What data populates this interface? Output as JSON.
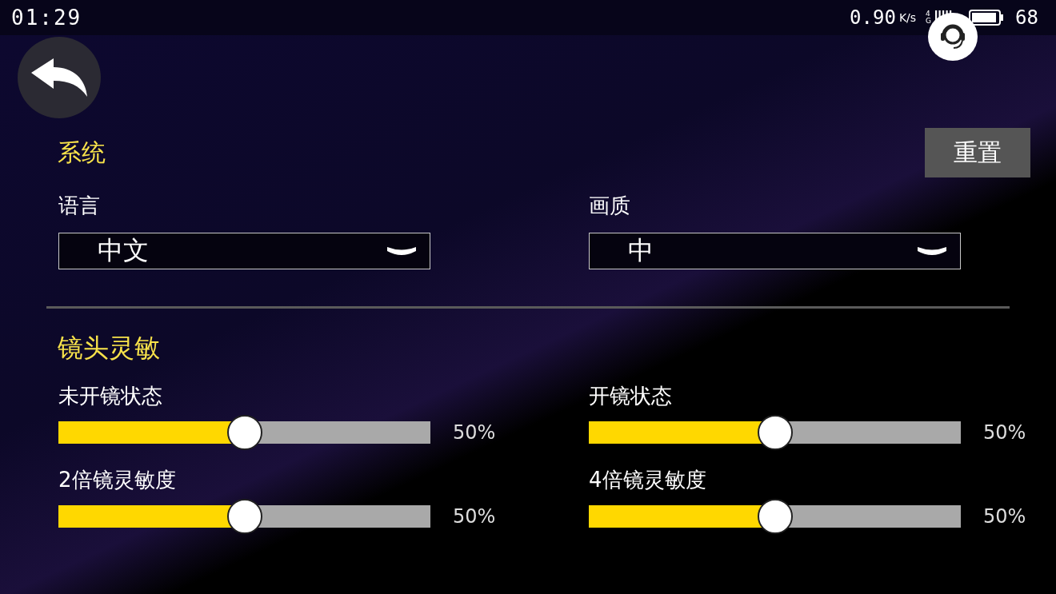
{
  "status_bar": {
    "time": "01:29",
    "speed": "0.90",
    "speed_unit": "K/s",
    "network": "4G",
    "battery_level": "68"
  },
  "system": {
    "title": "系统",
    "reset_button": "重置",
    "fields": [
      {
        "label": "语言",
        "value": "中文"
      },
      {
        "label": "画质",
        "value": "中"
      }
    ]
  },
  "camera_sensitivity": {
    "title": "镜头灵敏",
    "sliders": [
      {
        "label": "未开镜状态",
        "level": 0.5,
        "reading": "50%"
      },
      {
        "label": "开镜状态",
        "level": 0.5,
        "reading": "50%"
      },
      {
        "label": "2倍镜灵敏度",
        "level": 0.5,
        "reading": "50%"
      },
      {
        "label": "4倍镜灵敏度",
        "level": 0.5,
        "reading": "50%"
      }
    ]
  }
}
